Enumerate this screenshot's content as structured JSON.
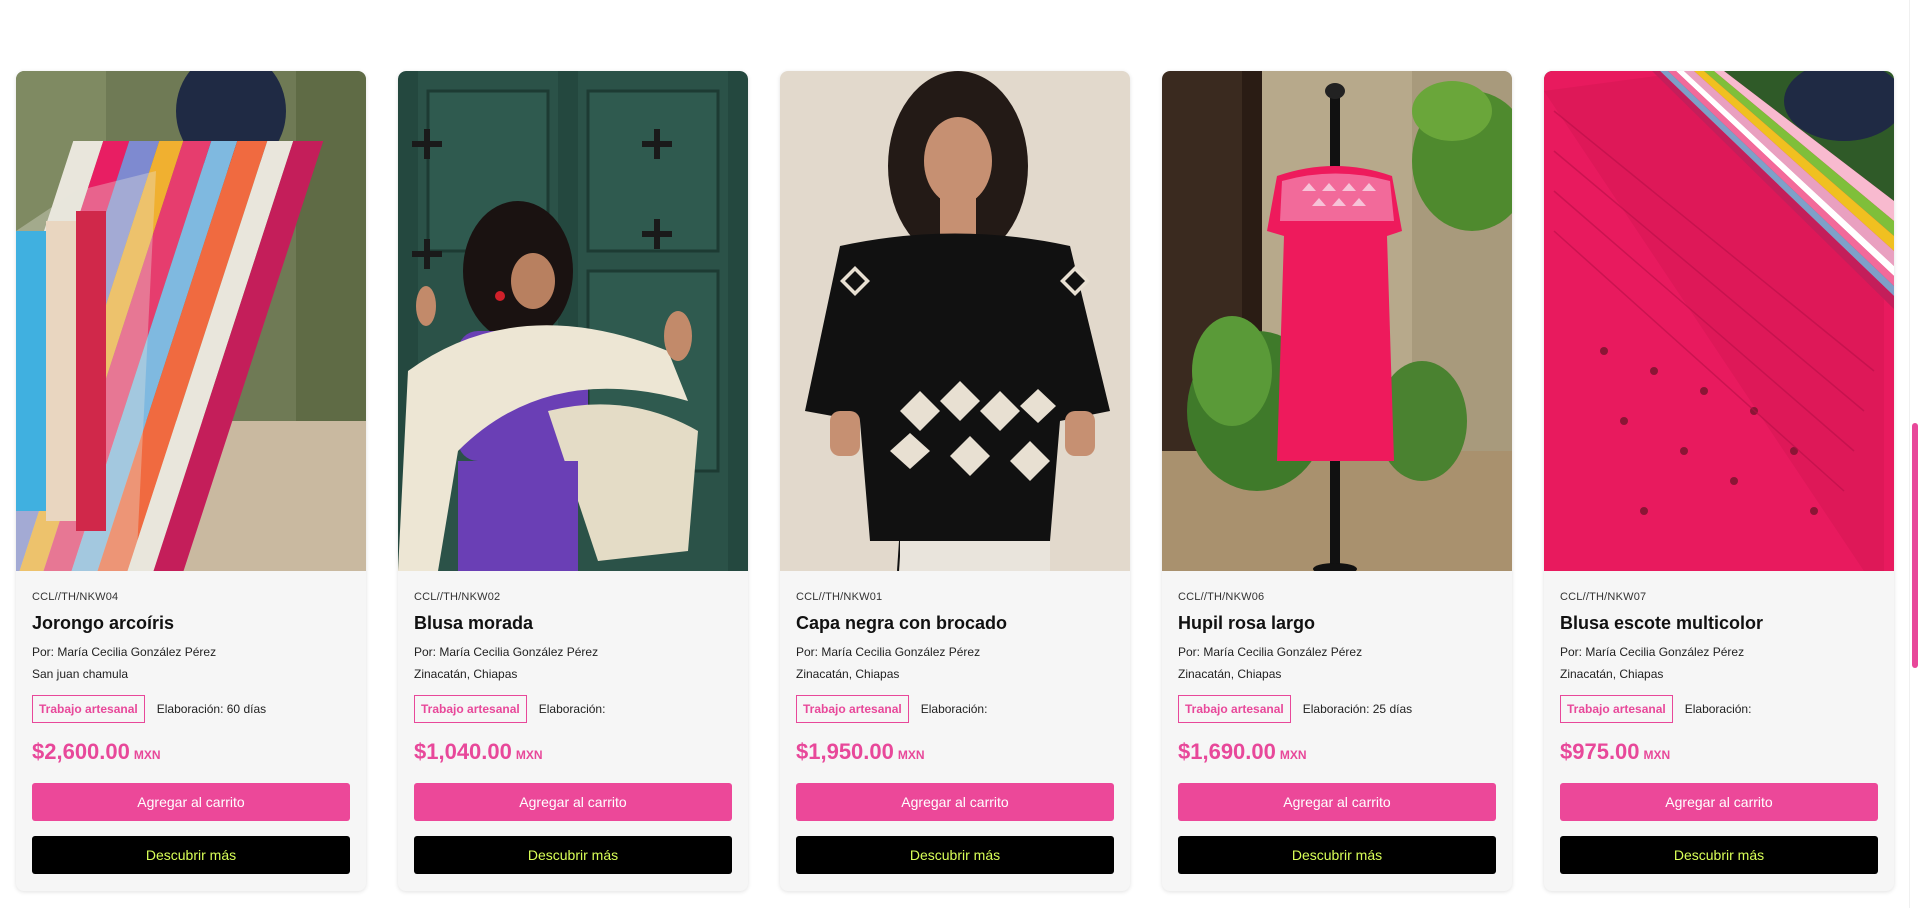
{
  "products": [
    {
      "sku": "CCL//TH/NKW04",
      "title": "Jorongo arcoíris",
      "author": "Por: María Cecilia González Pérez",
      "location": "San juan chamula",
      "badge": "Trabajo artesanal",
      "elaboration": "Elaboración: 60 días",
      "price": "$2,600.00",
      "currency": "MXN",
      "cart_label": "Agregar al carrito",
      "more_label": "Descubrir más",
      "image": "rainbow-poncho-photo"
    },
    {
      "sku": "CCL//TH/NKW02",
      "title": "Blusa morada",
      "author": "Por: María Cecilia González Pérez",
      "location": "Zinacatán, Chiapas",
      "badge": "Trabajo artesanal",
      "elaboration": "Elaboración:",
      "price": "$1,040.00",
      "currency": "MXN",
      "cart_label": "Agregar al carrito",
      "more_label": "Descubrir más",
      "image": "purple-blouse-photo"
    },
    {
      "sku": "CCL//TH/NKW01",
      "title": "Capa negra con brocado",
      "author": "Por: María Cecilia González Pérez",
      "location": "Zinacatán, Chiapas",
      "badge": "Trabajo artesanal",
      "elaboration": "Elaboración:",
      "price": "$1,950.00",
      "currency": "MXN",
      "cart_label": "Agregar al carrito",
      "more_label": "Descubrir más",
      "image": "black-cape-photo"
    },
    {
      "sku": "CCL//TH/NKW06",
      "title": "Hupil rosa largo",
      "author": "Por: María Cecilia González Pérez",
      "location": "Zinacatán, Chiapas",
      "badge": "Trabajo artesanal",
      "elaboration": "Elaboración: 25 días",
      "price": "$1,690.00",
      "currency": "MXN",
      "cart_label": "Agregar al carrito",
      "more_label": "Descubrir más",
      "image": "pink-huipil-photo"
    },
    {
      "sku": "CCL//TH/NKW07",
      "title": "Blusa escote multicolor",
      "author": "Por: María Cecilia González Pérez",
      "location": "Zinacatán, Chiapas",
      "badge": "Trabajo artesanal",
      "elaboration": "Elaboración:",
      "price": "$975.00",
      "currency": "MXN",
      "cart_label": "Agregar al carrito",
      "more_label": "Descubrir más",
      "image": "multicolor-blouse-photo"
    }
  ],
  "colors": {
    "accent": "#ec4899",
    "button_dark": "#000000",
    "button_dark_text": "#d9ff57"
  }
}
